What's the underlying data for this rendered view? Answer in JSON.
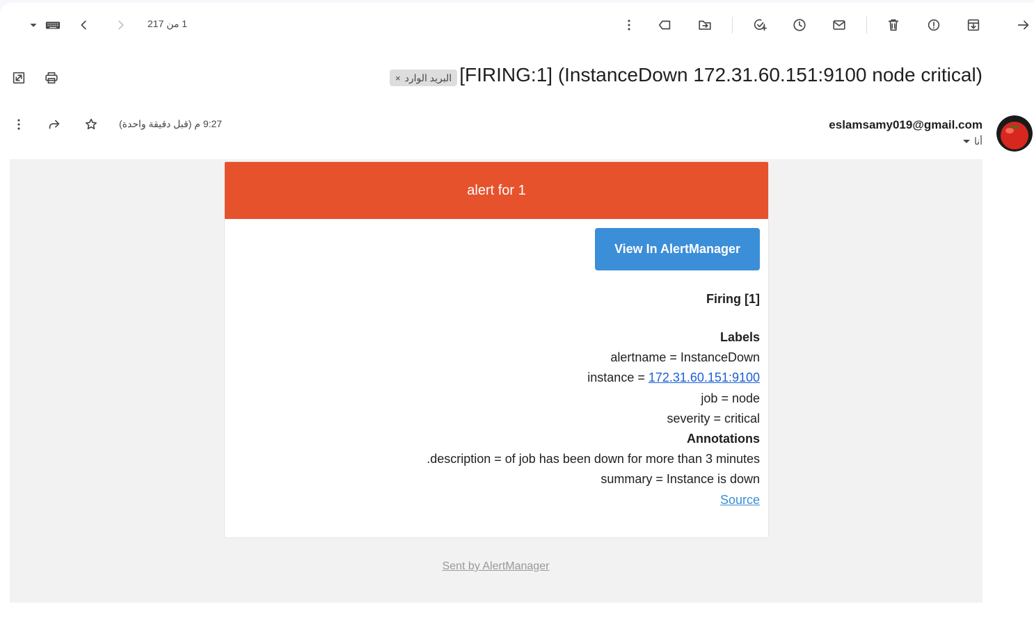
{
  "toolbar": {
    "counter": "1 من 217"
  },
  "subject": {
    "title": "[FIRING:1] (InstanceDown 172.31.60.151:9100 node critical)",
    "label_chip": "البريد الوارد",
    "label_chip_remove": "×"
  },
  "message": {
    "sender": "eslamsamy019@gmail.com",
    "to": "أنا",
    "time": "9:27 م (قبل دقيقة واحدة)"
  },
  "email_body": {
    "banner": "alert for 1",
    "button": "View In AlertManager",
    "firing": "Firing [1]",
    "labels_heading": "Labels",
    "alertname": "alertname = InstanceDown",
    "instance_prefix": "instance = ",
    "instance_link": "172.31.60.151:9100",
    "job": "job = node",
    "severity": "severity = critical",
    "annotations_heading": "Annotations",
    "description": ".description = of job has been down for more than 3 minutes",
    "summary": "summary = Instance is down",
    "source": "Source",
    "footer": "Sent by AlertManager"
  },
  "colors": {
    "banner": "#e6522c",
    "button": "#3b8ed8",
    "link": "#1a5fd6"
  }
}
